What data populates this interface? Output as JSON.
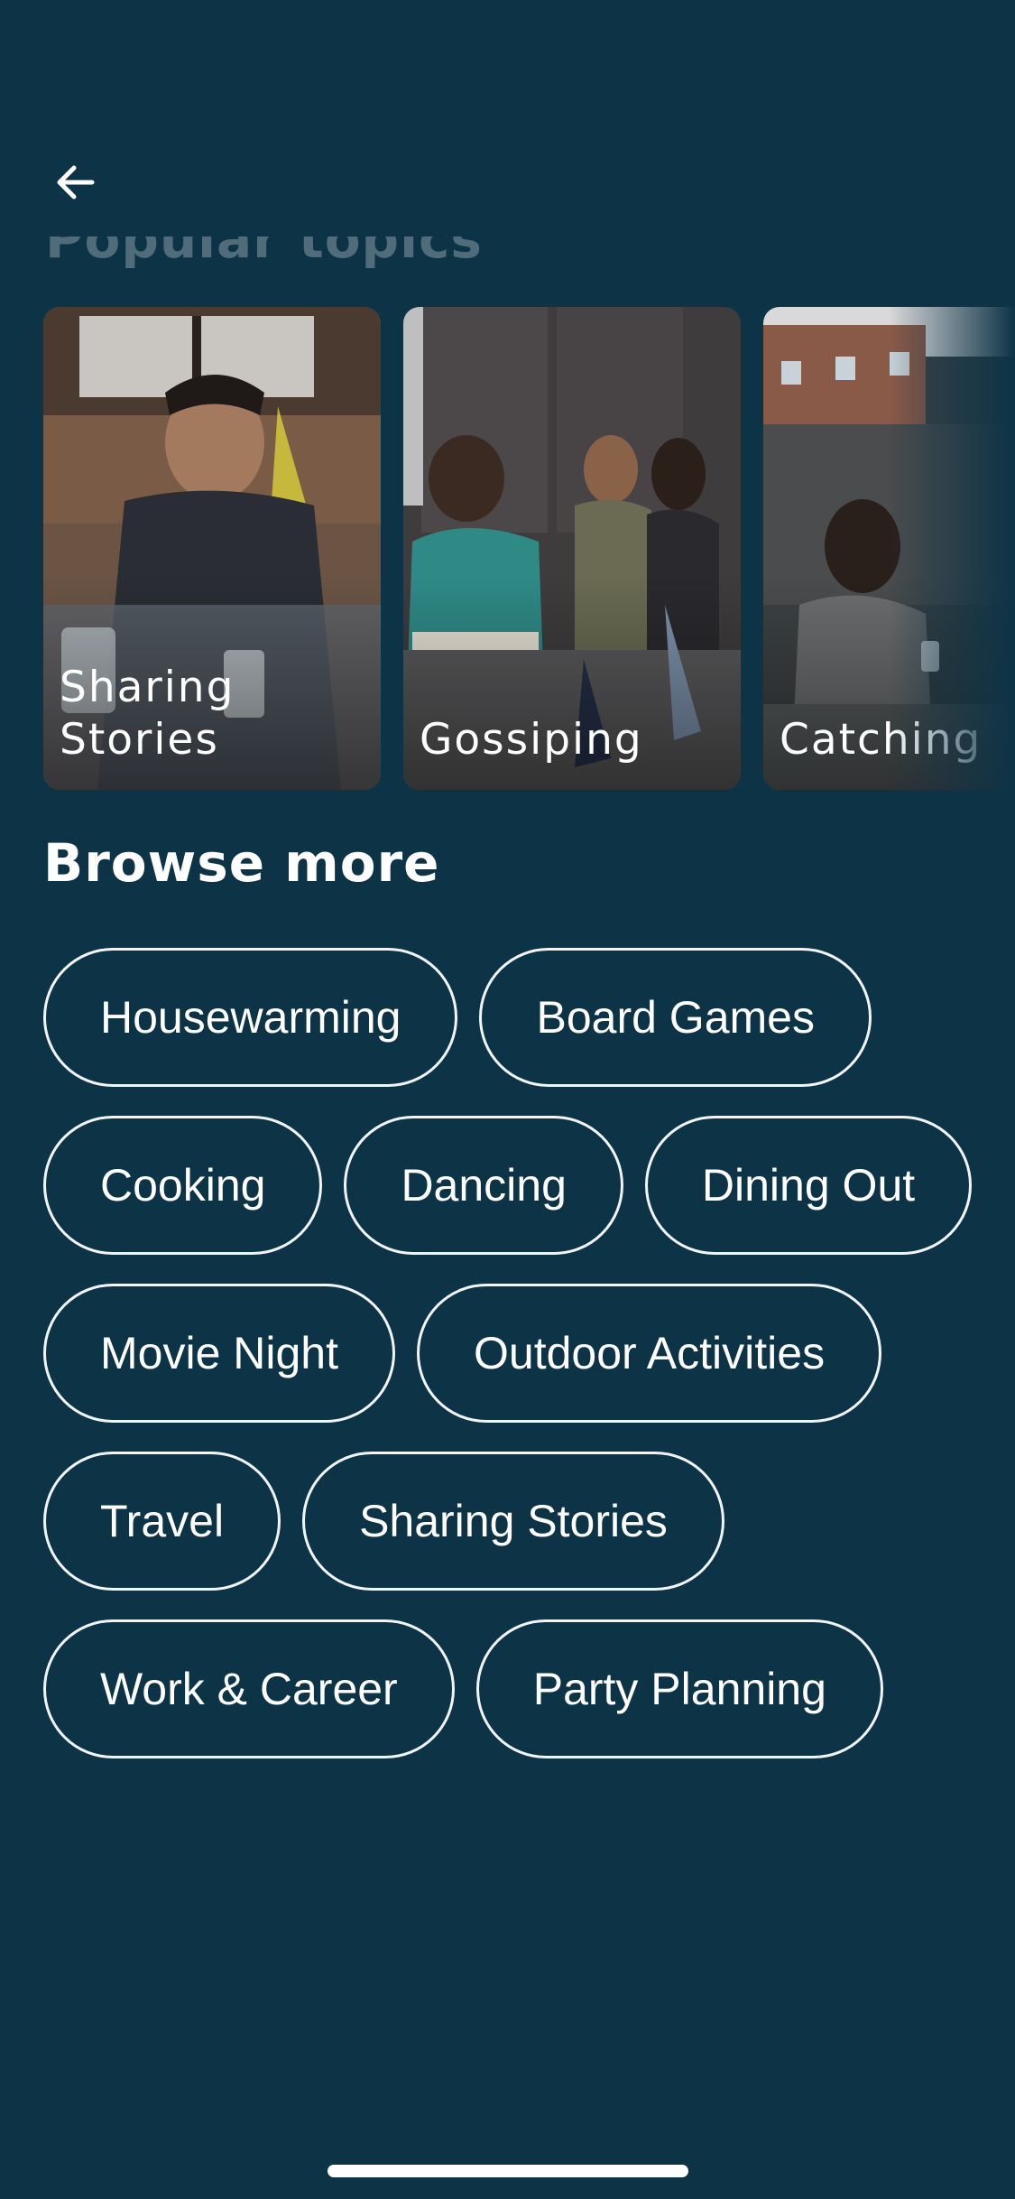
{
  "header": {
    "faded_section_title": "Popular topics"
  },
  "popular_topics": [
    {
      "label": "Sharing\nStories"
    },
    {
      "label": "Gossiping"
    },
    {
      "label": "Catching"
    }
  ],
  "browse": {
    "title": "Browse more",
    "chips": [
      "Housewarming",
      "Board Games",
      "Cooking",
      "Dancing",
      "Dining Out",
      "Movie Night",
      "Outdoor Activities",
      "Travel",
      "Sharing Stories",
      "Work & Career",
      "Party Planning"
    ]
  },
  "colors": {
    "background": "#0d3347",
    "chip_border": "#f2f5f7",
    "text": "#ffffff"
  }
}
